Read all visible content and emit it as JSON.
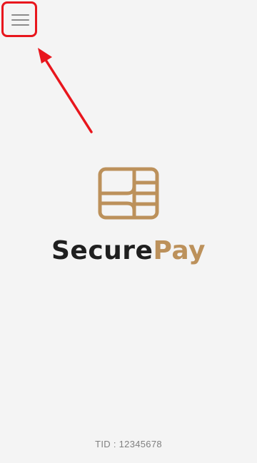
{
  "header": {
    "menu_icon": "hamburger-menu-icon",
    "menu_highlight_color": "#e8161d"
  },
  "annotation": {
    "type": "arrow",
    "color": "#e8161d",
    "points_to": "menu-button"
  },
  "logo": {
    "icon": "card-chip-icon",
    "name_part_1": "Secure",
    "name_part_2": "Pay",
    "primary_color": "#1f1f1f",
    "accent_color": "#bc915b"
  },
  "footer": {
    "tid_label": "TID : 12345678"
  }
}
